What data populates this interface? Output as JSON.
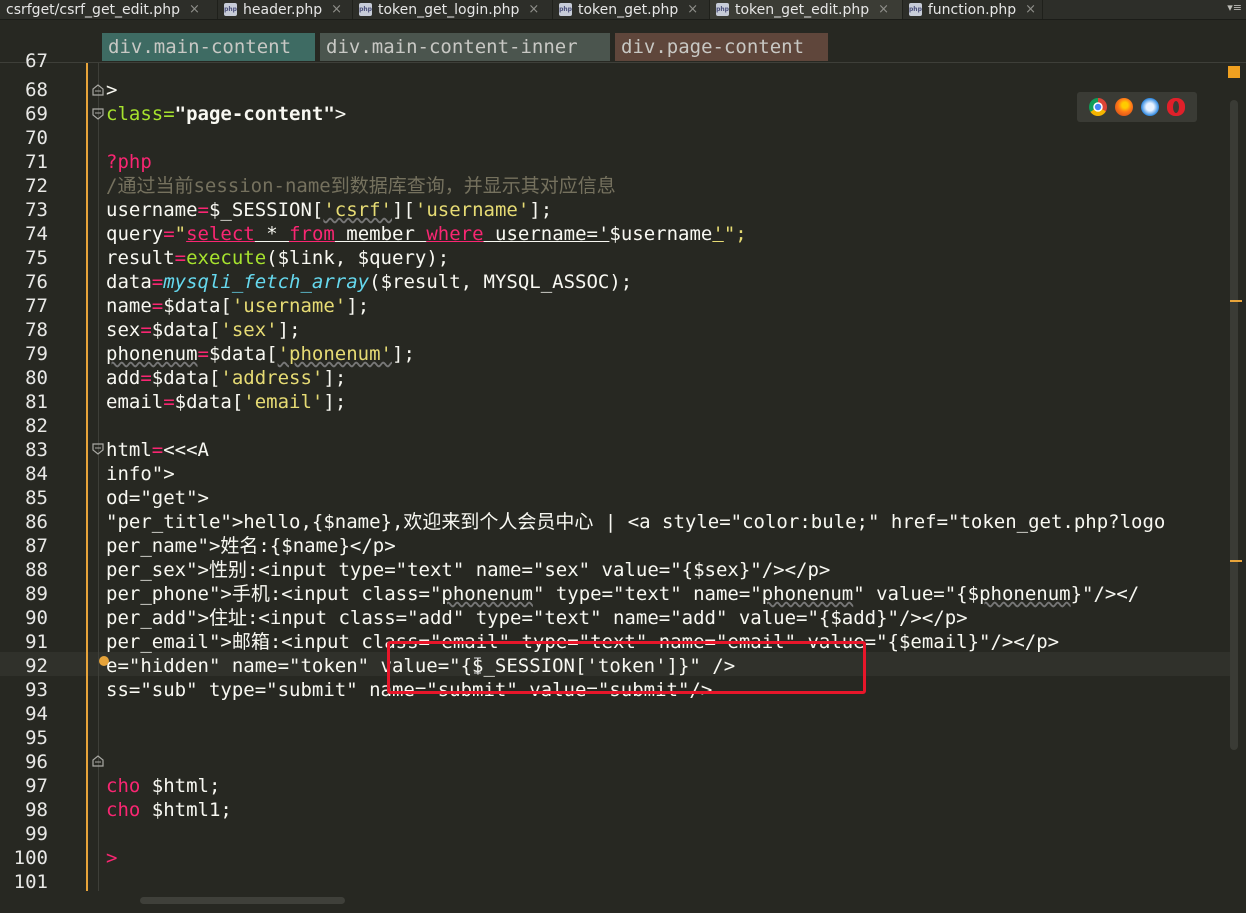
{
  "tabs": [
    {
      "label": "csrfget/csrf_get_edit.php",
      "active": false,
      "has_icon": false
    },
    {
      "label": "header.php",
      "active": false,
      "has_icon": true
    },
    {
      "label": "token_get_login.php",
      "active": false,
      "has_icon": true
    },
    {
      "label": "token_get.php",
      "active": false,
      "has_icon": true
    },
    {
      "label": "token_get_edit.php",
      "active": true,
      "has_icon": true
    },
    {
      "label": "function.php",
      "active": false,
      "has_icon": true
    }
  ],
  "tab_overflow": "▾≡",
  "breadcrumb": [
    "div.main-content",
    "div.main-content-inner",
    "div.page-content"
  ],
  "lines": [
    "67",
    "68",
    "69",
    "70",
    "71",
    "72",
    "73",
    "74",
    "75",
    "76",
    "77",
    "78",
    "79",
    "80",
    "81",
    "82",
    "83",
    "84",
    "85",
    "86",
    "87",
    "88",
    "89",
    "90",
    "91",
    "92",
    "93",
    "94",
    "95",
    "96",
    "97",
    "98",
    "99",
    "100",
    "101"
  ],
  "code": {
    "l68": ">",
    "l69_class": "class=",
    "l69_val": "\"page-content\"",
    "l69_end": ">",
    "l71": "?php",
    "l72": "/通过当前session-name到数据库查询，并显示其对应信息",
    "l73_a": "username",
    "l73_eq": "=",
    "l73_b": "$_SESSION[",
    "l73_s1": "'csrf'",
    "l73_c": "][",
    "l73_s2": "'username'",
    "l73_d": "];",
    "l74_a": "query",
    "l74_eq": "=",
    "l74_q": "\"",
    "l74_select": "select",
    "l74_star": " * ",
    "l74_from": "from",
    "l74_member": " member ",
    "l74_where": "where",
    "l74_cond": " username='",
    "l74_var": "$username",
    "l74_q2": "'",
    "l74_end": "\";",
    "l75_a": "result",
    "l75_eq": "=",
    "l75_fn": "execute",
    "l75_b": "($link, $query);",
    "l76_a": "data",
    "l76_eq": "=",
    "l76_fn": "mysqli_fetch_array",
    "l76_b": "($result, MYSQL_ASSOC);",
    "l77_a": "name",
    "l77_b": "$data[",
    "l77_s": "'username'",
    "l77_c": "];",
    "l78_a": "sex",
    "l78_s": "'sex'",
    "l79_a": "phonenum",
    "l79_s": "'phonenum'",
    "l80_a": "add",
    "l80_s": "'address'",
    "l81_a": "email",
    "l81_s": "'email'",
    "l83_a": "html",
    "l83_b": "<<<A",
    "l84": "info\">",
    "l85": "od=\"get\">",
    "l86": "\"per_title\">hello,{$name},欢迎来到个人会员中心 | <a style=\"color:bule;\" href=\"token_get.php?logo",
    "l87": "per_name\">姓名:{$name}</p>",
    "l88": "per_sex\">性别:<input type=\"text\" name=\"sex\" value=\"{$sex}\"/></p>",
    "l89_a": "per_phone\">手机:<input class=\"",
    "l89_b": "phonenum",
    "l89_c": "\" type=\"text\" name=\"",
    "l89_d": "phonenum",
    "l89_e": "\" value=\"{$",
    "l89_f": "phonenum",
    "l89_g": "}\"/></",
    "l90": "per_add\">住址:<input class=\"add\" type=\"text\" name=\"add\" value=\"{$add}\"/></p>",
    "l91": "per_email\">邮箱:<input class=\"email\" type=\"text\" name=\"email\" value=\"{$email}\"/></p>",
    "l92": "e=\"hidden\" name=\"token\" value=\"{$_SESSION['token']}\" />",
    "l93": "ss=\"sub\" type=\"submit\" name=\"submit\" value=\"submit\"/>",
    "l97_kw": "cho",
    "l97_b": " $html;",
    "l98_kw": "cho",
    "l98_b": " $html1;",
    "l100": ">"
  },
  "colors": {
    "accent_ruler": "#e8a43a",
    "highlight_box": "#e8162a"
  },
  "browser_icons": [
    "chrome-icon",
    "firefox-icon",
    "safari-icon",
    "opera-icon"
  ]
}
